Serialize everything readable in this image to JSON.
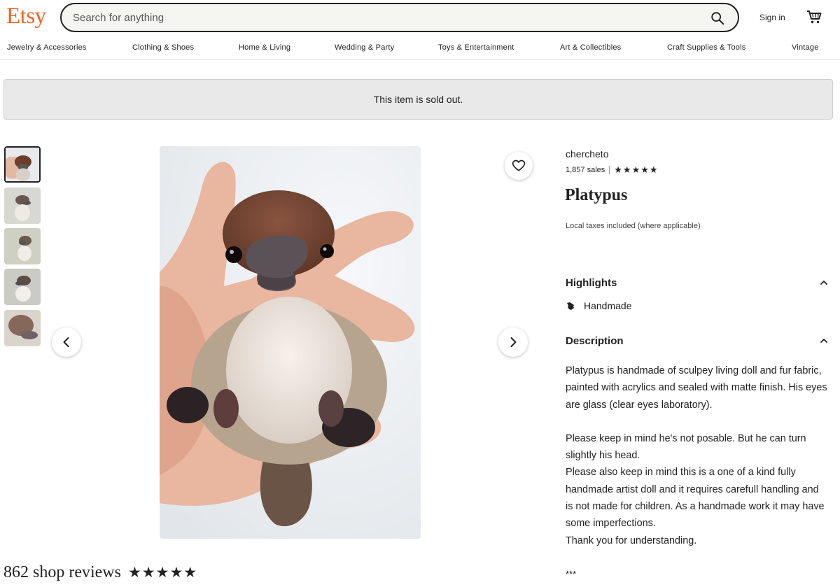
{
  "header": {
    "logo": "Etsy",
    "search_placeholder": "Search for anything",
    "sign_in": "Sign in"
  },
  "categories": [
    "Jewelry & Accessories",
    "Clothing & Shoes",
    "Home & Living",
    "Wedding & Party",
    "Toys & Entertainment",
    "Art & Collectibles",
    "Craft Supplies & Tools",
    "Vintage"
  ],
  "banner": {
    "text": "This item is sold out."
  },
  "listing": {
    "shop_name": "chercheto",
    "sales": "1,857 sales",
    "shop_rating_stars": 5,
    "title": "Platypus",
    "taxes_note": "Local taxes included (where applicable)"
  },
  "highlights": {
    "heading": "Highlights",
    "items": [
      "Handmade"
    ]
  },
  "description": {
    "heading": "Description",
    "paragraph1": "Platypus is handmade of sculpey living doll and fur fabric, painted with acrylics and sealed with matte finish. His eyes are glass (clear eyes laboratory).",
    "line1": "Please keep in mind he's not posable. But he can turn slightly his head.",
    "line2": "Please also keep in mind this is a one of a kind fully handmade artist doll and it requires carefull handling and is not made for children. As a handmade work it may have some imperfections.",
    "line3": "Thank you for understanding.",
    "separator": "***"
  },
  "reviews": {
    "label": "862 shop reviews",
    "stars": 5
  },
  "gallery": {
    "thumbnail_count": 5,
    "selected_index": 0
  },
  "colors": {
    "brand": "#F1641E",
    "text": "#222222",
    "banner_bg": "#e9e9e9"
  }
}
